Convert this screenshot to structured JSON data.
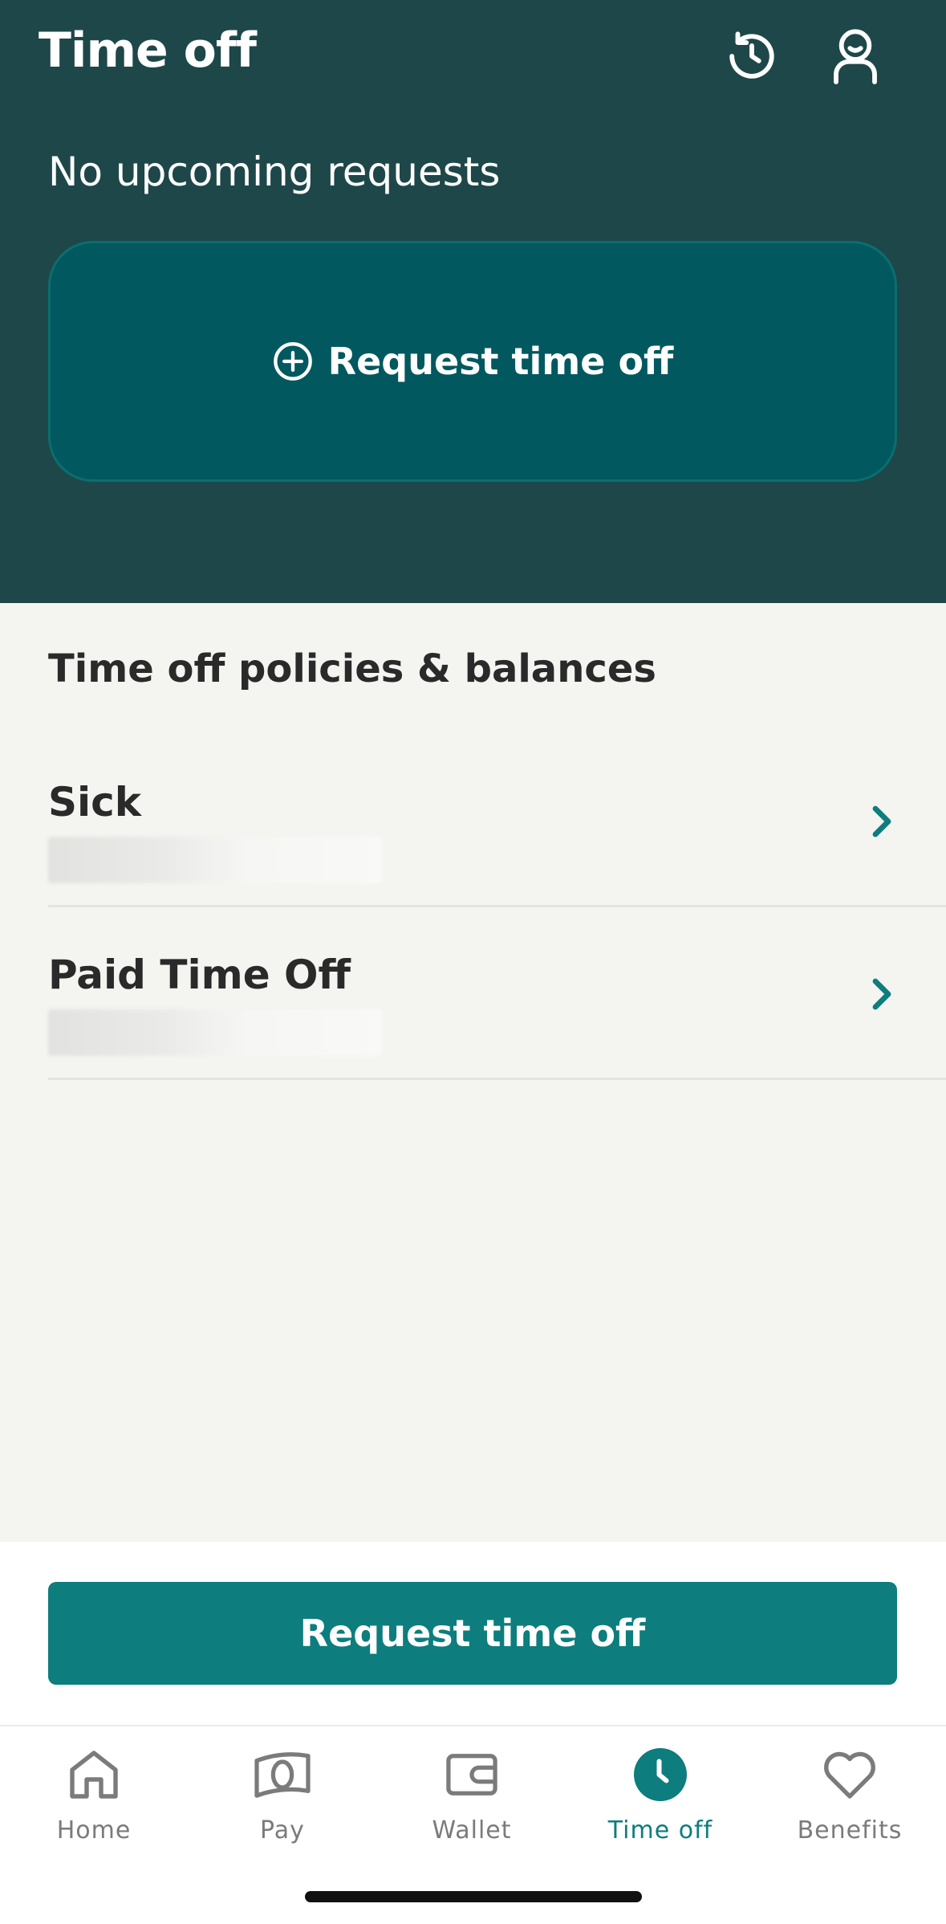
{
  "header": {
    "title": "Time off",
    "history_icon": "history-icon",
    "profile_icon": "profile-icon",
    "status": "No upcoming requests",
    "request_card_label": "Request time off",
    "request_card_icon": "plus-circle-icon"
  },
  "policies": {
    "title": "Time off policies & balances",
    "items": [
      {
        "name": "Sick",
        "balance": ""
      },
      {
        "name": "Paid Time Off",
        "balance": ""
      }
    ]
  },
  "bottom_button": {
    "label": "Request time off"
  },
  "tabbar": {
    "active": "Time off",
    "items": [
      {
        "label": "Home",
        "icon": "home-icon"
      },
      {
        "label": "Pay",
        "icon": "money-icon"
      },
      {
        "label": "Wallet",
        "icon": "wallet-icon"
      },
      {
        "label": "Time off",
        "icon": "clock-icon"
      },
      {
        "label": "Benefits",
        "icon": "heart-icon"
      }
    ]
  },
  "colors": {
    "header_bg": "#1e4749",
    "card_bg": "#02585f",
    "accent": "#0d7d7d",
    "page_bg": "#f4f4f1"
  }
}
